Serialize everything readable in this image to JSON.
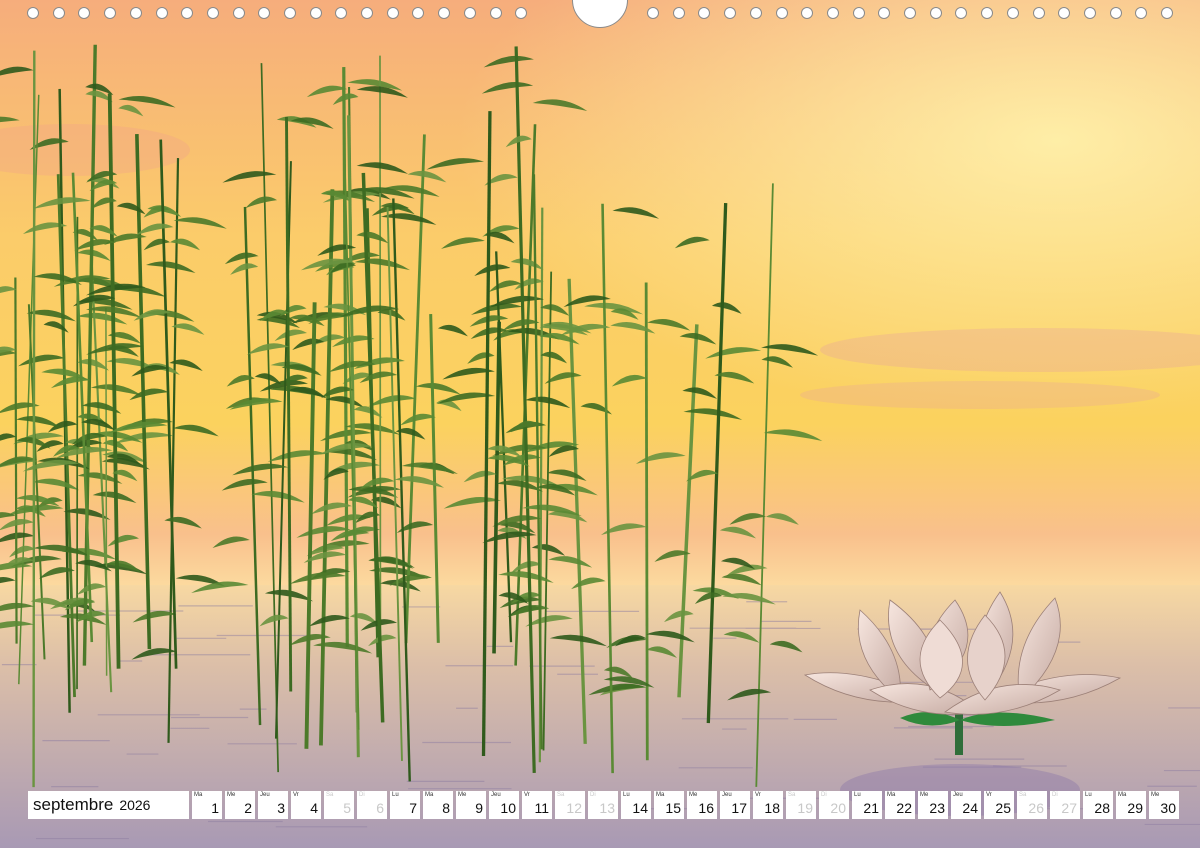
{
  "calendar": {
    "month": "septembre",
    "year": "2026",
    "days": [
      {
        "day_name": "Ma",
        "number": "1",
        "weekend": false
      },
      {
        "day_name": "Me",
        "number": "2",
        "weekend": false
      },
      {
        "day_name": "Jeu",
        "number": "3",
        "weekend": false
      },
      {
        "day_name": "Vr",
        "number": "4",
        "weekend": false
      },
      {
        "day_name": "Sa",
        "number": "5",
        "weekend": true
      },
      {
        "day_name": "Di",
        "number": "6",
        "weekend": true
      },
      {
        "day_name": "Lu",
        "number": "7",
        "weekend": false
      },
      {
        "day_name": "Ma",
        "number": "8",
        "weekend": false
      },
      {
        "day_name": "Me",
        "number": "9",
        "weekend": false
      },
      {
        "day_name": "Jeu",
        "number": "10",
        "weekend": false
      },
      {
        "day_name": "Vr",
        "number": "11",
        "weekend": false
      },
      {
        "day_name": "Sa",
        "number": "12",
        "weekend": true
      },
      {
        "day_name": "Di",
        "number": "13",
        "weekend": true
      },
      {
        "day_name": "Lu",
        "number": "14",
        "weekend": false
      },
      {
        "day_name": "Ma",
        "number": "15",
        "weekend": false
      },
      {
        "day_name": "Me",
        "number": "16",
        "weekend": false
      },
      {
        "day_name": "Jeu",
        "number": "17",
        "weekend": false
      },
      {
        "day_name": "Vr",
        "number": "18",
        "weekend": false
      },
      {
        "day_name": "Sa",
        "number": "19",
        "weekend": true
      },
      {
        "day_name": "Di",
        "number": "20",
        "weekend": true
      },
      {
        "day_name": "Lu",
        "number": "21",
        "weekend": false
      },
      {
        "day_name": "Ma",
        "number": "22",
        "weekend": false
      },
      {
        "day_name": "Me",
        "number": "23",
        "weekend": false
      },
      {
        "day_name": "Jeu",
        "number": "24",
        "weekend": false
      },
      {
        "day_name": "Vr",
        "number": "25",
        "weekend": false
      },
      {
        "day_name": "Sa",
        "number": "26",
        "weekend": true
      },
      {
        "day_name": "Di",
        "number": "27",
        "weekend": true
      },
      {
        "day_name": "Lu",
        "number": "28",
        "weekend": false
      },
      {
        "day_name": "Ma",
        "number": "29",
        "weekend": false
      },
      {
        "day_name": "Me",
        "number": "30",
        "weekend": false
      }
    ]
  },
  "colors": {
    "sky_top": "#f7b07a",
    "sky_mid": "#fbd85e",
    "horizon": "#fce9a8",
    "water": "#b9a4b8",
    "bamboo": "#3e6a22",
    "lotus": "#e9d2cc",
    "weekend_text": "#c8c8c8"
  },
  "icons": [
    "binding-hole-icon",
    "hanger-icon",
    "bamboo-illustration",
    "lotus-flower-illustration"
  ]
}
